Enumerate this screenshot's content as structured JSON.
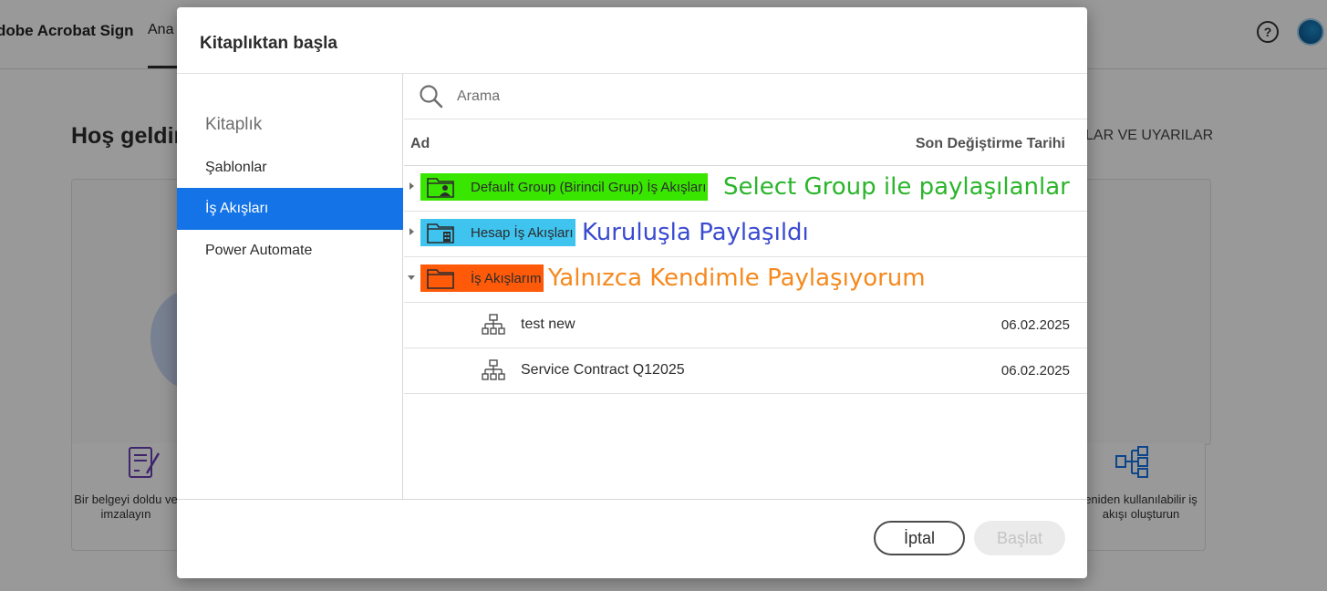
{
  "app": {
    "brand": "dobe Acrobat Sign",
    "nav_tab": "Ana",
    "help_icon_text": "?",
    "welcome": "Hoş geldin",
    "alerts_label": "LAR VE UYARILAR",
    "tile_left_text": "Bir belgeyi doldu ve imzalayın",
    "tile_right_text": "eniden kullanılabilir iş akışı oluşturun"
  },
  "modal": {
    "title": "Kitaplıktan başla",
    "sidebar": {
      "heading": "Kitaplık",
      "items": [
        {
          "label": "Şablonlar",
          "active": false
        },
        {
          "label": "İş Akışları",
          "active": true
        },
        {
          "label": "Power Automate",
          "active": false
        }
      ]
    },
    "search": {
      "placeholder": "Arama",
      "value": ""
    },
    "columns": {
      "name": "Ad",
      "date": "Son Değiştirme Tarihi"
    },
    "folders": [
      {
        "label": "Default Group (Birincil Grup) İş Akışları",
        "highlight": "#39e600",
        "annotation": "Select Group ile paylaşılanlar",
        "annotation_color": "#2bb52b",
        "expanded": false,
        "icon": "group-folder-icon"
      },
      {
        "label": "Hesap İş Akışları",
        "highlight": "#3fc3ef",
        "annotation": "Kuruluşla Paylaşıldı",
        "annotation_color": "#3a4bd0",
        "expanded": false,
        "icon": "account-folder-icon"
      },
      {
        "label": "İş Akışlarım",
        "highlight": "#ff5a09",
        "annotation": "Yalnızca Kendimle Paylaşıyorum",
        "annotation_color": "#f5891e",
        "expanded": true,
        "icon": "folder-icon"
      }
    ],
    "workflows": [
      {
        "name": "test new",
        "date": "06.02.2025"
      },
      {
        "name": "Service Contract Q12025",
        "date": "06.02.2025"
      }
    ],
    "buttons": {
      "cancel": "İptal",
      "start": "Başlat"
    }
  }
}
